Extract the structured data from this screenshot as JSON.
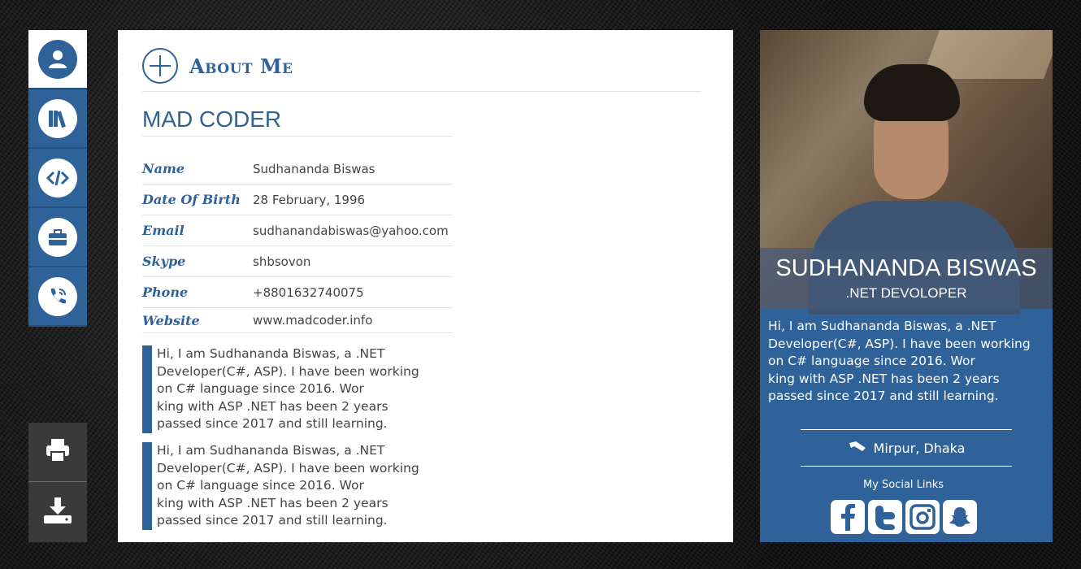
{
  "nav": {
    "items": [
      {
        "icon": "user-icon",
        "active": true
      },
      {
        "icon": "books-icon",
        "active": false
      },
      {
        "icon": "code-icon",
        "active": false
      },
      {
        "icon": "briefcase-icon",
        "active": false
      },
      {
        "icon": "phone-icon",
        "active": false
      }
    ]
  },
  "tools": {
    "print_icon": "print-icon",
    "download_icon": "download-icon"
  },
  "about": {
    "title": "About Me",
    "subtitle": "MAD CODER",
    "info": [
      {
        "label": "Name",
        "value": "Sudhananda Biswas"
      },
      {
        "label": "Date Of Birth",
        "value": "28 February, 1996"
      },
      {
        "label": "Email",
        "value": "sudhanandabiswas@yahoo.com"
      },
      {
        "label": "Skype",
        "value": "shbsovon"
      },
      {
        "label": "Phone",
        "value": "+8801632740075"
      },
      {
        "label": "Website",
        "value": "www.madcoder.info"
      }
    ],
    "quotes": [
      {
        "lines": [
          "Hi, I am Sudhananda Biswas, a .NET",
          "Developer(C#, ASP). I have been working",
          "on C# language since 2016. Wor",
          "king with ASP .NET has been 2 years",
          "passed since 2017 and still learning."
        ]
      },
      {
        "lines": [
          "Hi, I am Sudhananda Biswas, a .NET",
          "Developer(C#, ASP). I have been working",
          "on C# language since 2016. Wor",
          "king with ASP .NET has been 2 years",
          "passed since 2017 and still learning."
        ]
      }
    ]
  },
  "profile": {
    "name": "SUDHANANDA BISWAS",
    "role": ".NET DEVOLOPER",
    "bio_lines": [
      "Hi, I am Sudhananda Biswas, a .NET",
      "Developer(C#, ASP). I have been working",
      "on C# language since 2016. Wor",
      "king with ASP .NET has been 2 years",
      "passed since 2017 and still learning."
    ],
    "location": "Mirpur, Dhaka",
    "social_title": "My Social Links",
    "social": [
      {
        "icon": "facebook-icon",
        "glyph": "f"
      },
      {
        "icon": "twitter-icon",
        "glyph": "t"
      },
      {
        "icon": "instagram-icon",
        "glyph": "ig"
      },
      {
        "icon": "snapchat-icon",
        "glyph": "sc"
      }
    ]
  },
  "colors": {
    "accent": "#2f6299",
    "toolbar": "#3a3a3a"
  }
}
